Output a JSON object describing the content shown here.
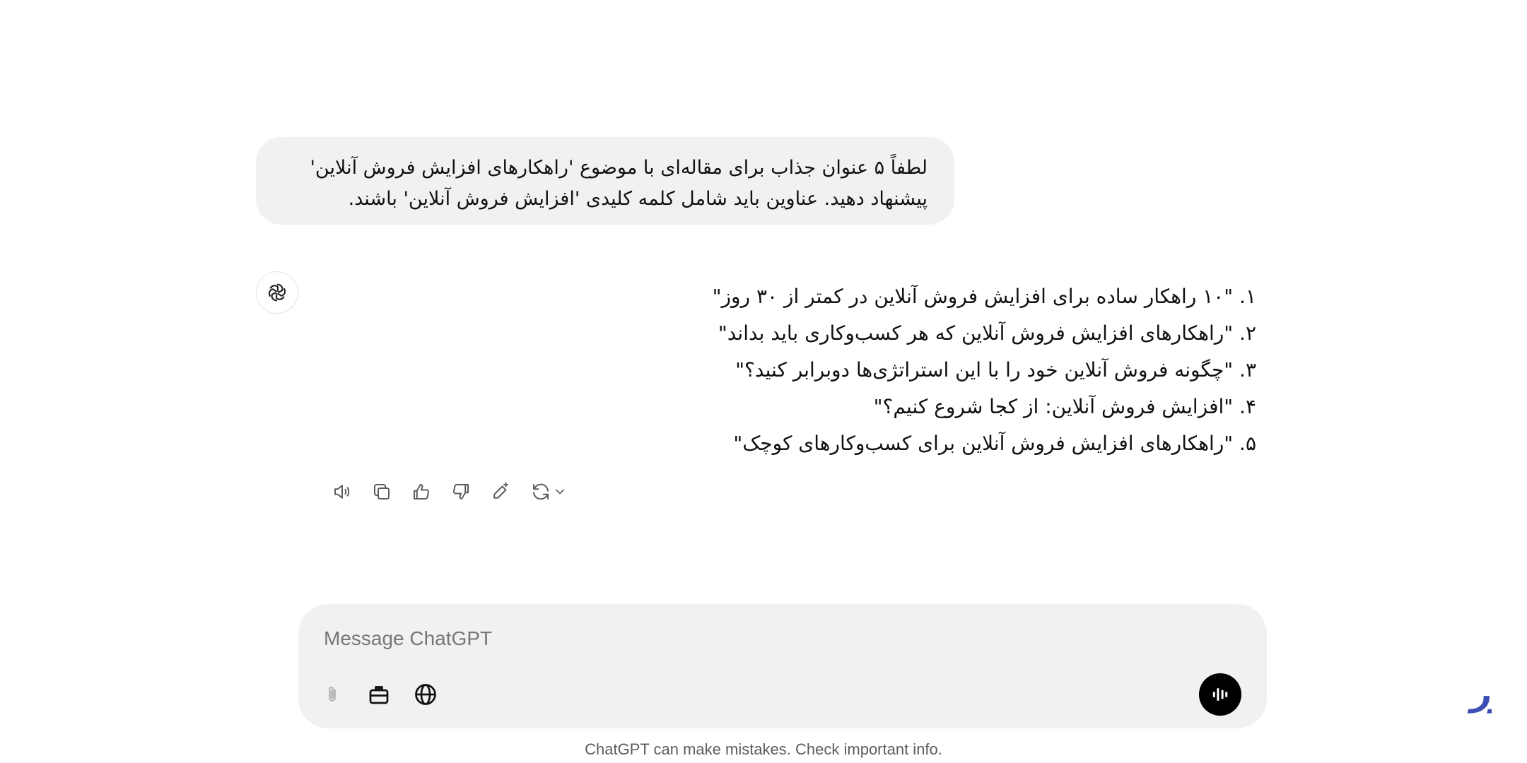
{
  "conversation": {
    "user_message": {
      "line1": "لطفاً ۵ عنوان جذاب برای مقاله‌ای با موضوع 'راهکارهای افزایش فروش آنلاین'",
      "line2": "پیشنهاد دهید. عناوین باید شامل کلمه کلیدی 'افزایش فروش آنلاین' باشند."
    },
    "assistant_message": {
      "items": [
        "۱. \"۱۰ راهکار ساده برای افزایش فروش آنلاین در کمتر از ۳۰ روز\"",
        "۲. \"راهکارهای افزایش فروش آنلاین که هر کسب‌وکاری باید بداند\"",
        "۳. \"چگونه فروش آنلاین خود را با این استراتژی‌ها دوبرابر کنید؟\"",
        "۴. \"افزایش فروش آنلاین: از کجا شروع کنیم؟\"",
        "۵. \"راهکارهای افزایش فروش آنلاین برای کسب‌وکارهای کوچک\""
      ],
      "avatar_icon": "chatgpt-logo-icon"
    },
    "actions": [
      "read-aloud-icon",
      "copy-icon",
      "thumbs-up-icon",
      "thumbs-down-icon",
      "edit-canvas-icon",
      "regenerate-icon"
    ]
  },
  "composer": {
    "placeholder": "Message ChatGPT",
    "value": "",
    "tools": [
      "attach-icon",
      "tools-icon",
      "globe-icon"
    ],
    "voice_icon": "voice-mode-icon"
  },
  "footer": {
    "disclaimer": "ChatGPT can make mistakes. Check important info."
  },
  "watermark": {
    "text": "ایران‌سرور",
    "color": "#3d4fb5"
  }
}
